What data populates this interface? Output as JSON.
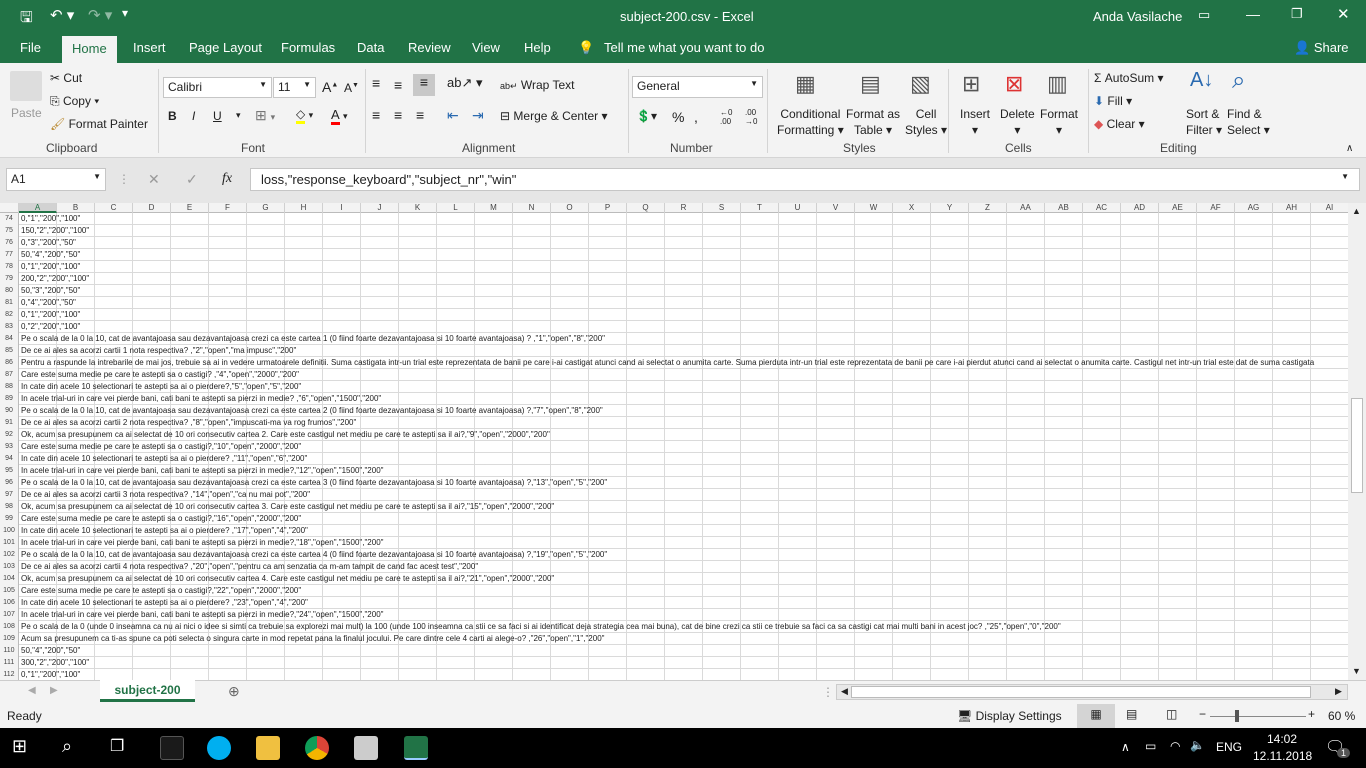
{
  "window": {
    "title": "subject-200.csv  -  Excel",
    "user": "Anda Vasilache"
  },
  "menu": {
    "tabs": [
      "File",
      "Home",
      "Insert",
      "Page Layout",
      "Formulas",
      "Data",
      "Review",
      "View",
      "Help"
    ],
    "tell_me": "Tell me what you want to do",
    "share": "Share"
  },
  "ribbon": {
    "clipboard": {
      "label": "Clipboard",
      "paste": "Paste",
      "cut": "Cut",
      "copy": "Copy",
      "format_painter": "Format Painter"
    },
    "font": {
      "label": "Font",
      "name": "Calibri",
      "size": "11",
      "fill_color": "#ffff00",
      "font_color": "#ff0000"
    },
    "alignment": {
      "label": "Alignment",
      "wrap_text": "Wrap Text",
      "merge_center": "Merge & Center"
    },
    "number": {
      "label": "Number",
      "format": "General"
    },
    "styles": {
      "label": "Styles",
      "conditional": "Conditional",
      "formatting": "Formatting",
      "format_as": "Format as",
      "table": "Table",
      "cell": "Cell",
      "styles": "Styles"
    },
    "cells": {
      "label": "Cells",
      "insert": "Insert",
      "delete": "Delete",
      "format": "Format"
    },
    "editing": {
      "label": "Editing",
      "autosum": "AutoSum",
      "fill": "Fill",
      "clear": "Clear",
      "sort_filter": "Sort &",
      "filter": "Filter",
      "find_select": "Find &",
      "select": "Select"
    }
  },
  "formula_bar": {
    "name_box": "A1",
    "fx": "fx",
    "content": "loss,\"response_keyboard\",\"subject_nr\",\"win\""
  },
  "columns": [
    "A",
    "B",
    "C",
    "D",
    "E",
    "F",
    "G",
    "H",
    "I",
    "J",
    "K",
    "L",
    "M",
    "N",
    "O",
    "P",
    "Q",
    "R",
    "S",
    "T",
    "U",
    "V",
    "W",
    "X",
    "Y",
    "Z",
    "AA",
    "AB",
    "AC",
    "AD",
    "AE",
    "AF",
    "AG",
    "AH",
    "AI"
  ],
  "rows": [
    [
      "74",
      "0,\"1\",\"200\",\"100\""
    ],
    [
      "75",
      "150,\"2\",\"200\",\"100\""
    ],
    [
      "76",
      "0,\"3\",\"200\",\"50\""
    ],
    [
      "77",
      "50,\"4\",\"200\",\"50\""
    ],
    [
      "78",
      "0,\"1\",\"200\",\"100\""
    ],
    [
      "79",
      "200,\"2\",\"200\",\"100\""
    ],
    [
      "80",
      "50,\"3\",\"200\",\"50\""
    ],
    [
      "81",
      "0,\"4\",\"200\",\"50\""
    ],
    [
      "82",
      "0,\"1\",\"200\",\"100\""
    ],
    [
      "83",
      "0,\"2\",\"200\",\"100\""
    ],
    [
      "84",
      "Pe o scala de la 0 la 10, cat de avantajoasa sau dezavantajoasa crezi ca este cartea 1 (0 fiind foarte dezavantajoasa si 10 foarte avantajoasa) ? ,\"1\",\"open\",\"8\",\"200\""
    ],
    [
      "85",
      "De ce ai ales sa acorzi cartii 1 nota respectiva?  ,\"2\",\"open\",\"ma impusc\",\"200\""
    ],
    [
      "86",
      "Pentru a raspunde la intrebarile de mai jos, trebuie sa ai in vedere urmatoarele definitii. Suma castigata intr-un trial este reprezentata de banii pe care i-ai castigat atunci cand ai selectat o anumita carte. Suma pierduta intr-un trial este reprezentata de banii pe care i-ai pierdut atunci cand ai selectat o anumita carte. Castigul net intr-un trial este dat de suma castigata"
    ],
    [
      "87",
      "Care este suma medie pe care te astepti sa o castigi? ,\"4\",\"open\",\"2000\",\"200\""
    ],
    [
      "88",
      " In cate din acele 10 selectionari te astepti sa ai o pierdere?,\"5\",\"open\",\"5\",\"200\""
    ],
    [
      "89",
      "In acele trial-uri in care vei pierde bani, cati bani te astepti sa pierzi in medie? ,\"6\",\"open\",\"1500\",\"200\""
    ],
    [
      "90",
      "Pe o scala de la 0 la 10, cat de avantajoasa sau dezavantajoasa crezi ca este cartea 2 (0 fiind foarte dezavantajoasa si 10 foarte avantajoasa) ?,\"7\",\"open\",\"8\",\"200\""
    ],
    [
      "91",
      "De ce ai ales sa acorzi cartii 2 nota respectiva? ,\"8\",\"open\",\"impuscati-ma va rog frumos\",\"200\""
    ],
    [
      "92",
      "Ok, acum sa presupunem ca ai selectat de 10 ori consecutiv cartea 2. Care este castigul net mediu pe care te astepti sa il ai?,\"9\",\"open\",\"2000\",\"200\""
    ],
    [
      "93",
      "Care este suma medie pe care te astepti sa o castigi?,\"10\",\"open\",\"2000\",\"200\""
    ],
    [
      "94",
      "In cate din acele 10 selectionari te astepti sa ai o pierdere? ,\"11\",\"open\",\"6\",\"200\""
    ],
    [
      "95",
      "In acele trial-uri in care vei pierde bani, cati bani te astepti sa pierzi in medie?,\"12\",\"open\",\"1500\",\"200\""
    ],
    [
      "96",
      "Pe o scala de la 0 la 10, cat de avantajoasa sau dezavantajoasa crezi ca este cartea 3 (0 fiind foarte dezavantajoasa si 10 foarte avantajoasa) ?,\"13\",\"open\",\"5\",\"200\""
    ],
    [
      "97",
      "De ce ai ales sa acorzi cartii 3 nota respectiva? ,\"14\",\"open\",\"ca nu mai pot\",\"200\""
    ],
    [
      "98",
      "Ok, acum sa presupunem ca ai selectat de 10 ori consecutiv cartea 3. Care este castigul net mediu pe care te astepti sa il ai?,\"15\",\"open\",\"2000\",\"200\""
    ],
    [
      "99",
      "Care este suma medie pe care te astepti sa o castigi?,\"16\",\"open\",\"2000\",\"200\""
    ],
    [
      "100",
      "In cate din acele 10 selectionari te astepti sa ai o pierdere? ,\"17\",\"open\",\"4\",\"200\""
    ],
    [
      "101",
      "In acele trial-uri in care vei pierde bani, cati bani te astepti sa pierzi in medie?,\"18\",\"open\",\"1500\",\"200\""
    ],
    [
      "102",
      "Pe o scala de la 0 la 10, cat de avantajoasa sau dezavantajoasa crezi ca este cartea 4 (0 fiind foarte dezavantajoasa si 10 foarte avantajoasa) ?,\"19\",\"open\",\"5\",\"200\""
    ],
    [
      "103",
      "De ce ai ales sa acorzi cartii 4 nota respectiva? ,\"20\",\"open\",\"pentru ca am senzatia ca m-am tampit de cand fac acest test\",\"200\""
    ],
    [
      "104",
      "Ok, acum sa presupunem ca ai selectat de 10 ori consecutiv cartea 4. Care este castigul net mediu pe care te astepti sa il ai?,\"21\",\"open\",\"2000\",\"200\""
    ],
    [
      "105",
      "Care este suma medie pe care te astepti sa o castigi?,\"22\",\"open\",\"2000\",\"200\""
    ],
    [
      "106",
      "In cate din acele 10 selectionari te astepti sa ai o pierdere? ,\"23\",\"open\",\"4\",\"200\""
    ],
    [
      "107",
      "In acele trial-uri in care vei pierde bani, cati bani te astepti sa pierzi in medie?,\"24\",\"open\",\"1500\",\"200\""
    ],
    [
      "108",
      "Pe o scala de la 0 (unde 0 inseamna ca nu ai nici o idee si simti ca trebuie sa explorezi mai mult) la 100 (unde 100 inseamna ca stii ce sa faci si ai identificat deja strategia cea mai buna), cat de bine crezi ca stii ce trebuie sa faci ca sa castigi cat mai multi bani in acest joc? ,\"25\",\"open\",\"0\",\"200\""
    ],
    [
      "109",
      "Acum sa presupunem ca ti-as spune ca poti selecta o singura carte in mod repetat pana la finalul jocului. Pe care dintre cele 4 carti ai alege-o? ,\"26\",\"open\",\"1\",\"200\""
    ],
    [
      "110",
      "50,\"4\",\"200\",\"50\""
    ],
    [
      "111",
      "300,\"2\",\"200\",\"100\""
    ],
    [
      "112",
      "0,\"1\",\"200\",\"100\""
    ]
  ],
  "sheet": {
    "tab": "subject-200"
  },
  "status": {
    "ready": "Ready",
    "display_settings": "Display Settings",
    "zoom": "60 %",
    "zoom_percent": 60
  },
  "taskbar": {
    "lang": "ENG",
    "time": "14:02",
    "date": "12.11.2018",
    "notifications": "1"
  }
}
